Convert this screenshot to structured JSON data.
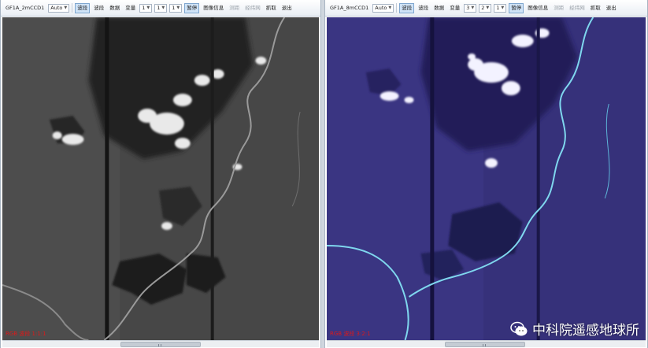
{
  "left": {
    "sensor": "GF1A_2mCCD1",
    "stretch": "Auto",
    "buttons": [
      "波段",
      "波段",
      "数据",
      "变量"
    ],
    "bands": [
      "1",
      "1",
      "1"
    ],
    "pause": "暂停",
    "info": "图像信息",
    "tools": [
      "测距",
      "经纬网",
      "抓取",
      "退出"
    ],
    "status": "RGB 波段 1:1:1"
  },
  "right": {
    "sensor": "GF1A_8mCCD1",
    "stretch": "Auto",
    "buttons": [
      "波段",
      "波段",
      "数据",
      "变量"
    ],
    "bands": [
      "3",
      "2",
      "1"
    ],
    "pause": "暂停",
    "info": "图像信息",
    "tools": [
      "测距",
      "经纬网",
      "抓取",
      "退出"
    ],
    "status": "RGB 波段 3:2:1"
  },
  "watermark": {
    "text": "中科院遥感地球所"
  },
  "icons": {
    "combo": "chevron-down-icon",
    "wechat": "wechat-icon"
  },
  "colors": {
    "left_bg": "#3d3d3d",
    "right_bg": "#2f2a6e",
    "status": "#e01818"
  }
}
